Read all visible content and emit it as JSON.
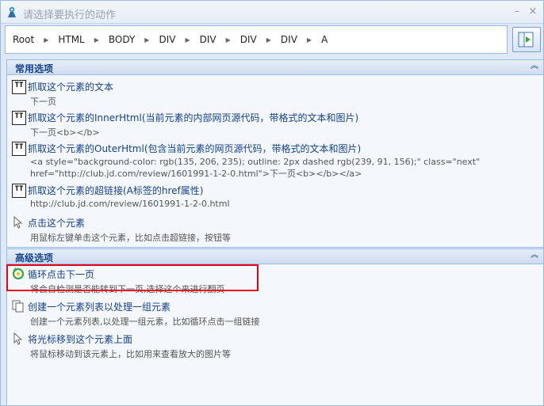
{
  "window": {
    "title": "请选择要执行的动作",
    "min_glyph": "–",
    "close_glyph": "×"
  },
  "breadcrumb": [
    "Root",
    "HTML",
    "BODY",
    "DIV",
    "DIV",
    "DIV",
    "DIV",
    "A"
  ],
  "common": {
    "title": "常用选项",
    "icon_text": "TT",
    "items": [
      {
        "label": "抓取这个元素的文本",
        "desc": "下一页"
      },
      {
        "label": "抓取这个元素的InnerHtml(当前元素的内部网页源代码，带格式的文本和图片)",
        "desc": "下一页<b></b>"
      },
      {
        "label": "抓取这个元素的OuterHtml(包含当前元素的网页源代码，带格式的文本和图片)",
        "desc": "<a style=\"background-color: rgb(135, 206, 235); outline: 2px dashed rgb(239, 91, 156);\" class=\"next\"",
        "desc2": "href=\"http://club.jd.com/review/1601991-1-2-0.html\">下一页<b></b></a>"
      },
      {
        "label": "抓取这个元素的超链接(A标签的href属性)",
        "desc": "http://club.jd.com/review/1601991-1-2-0.html"
      },
      {
        "label": "点击这个元素",
        "desc": "用鼠标左键单击这个元素，比如点击超链接，按钮等"
      }
    ]
  },
  "advanced": {
    "title": "高级选项",
    "items": [
      {
        "label": "循环点击下一页",
        "desc": "将会自检测是否能转到下一页,选择这个来进行翻页"
      },
      {
        "label": "创建一个元素列表以处理一组元素",
        "desc": "创建一个元素列表,以处理一组元素，比如循环点击一组链接"
      },
      {
        "label": "将光标移到这个元素上面",
        "desc": "将鼠标移动到该元素上，比如用来查看放大的图片等"
      }
    ]
  },
  "colors": {
    "accent": "#15428b",
    "border": "#99bbe8",
    "highlight": "#e60012"
  }
}
